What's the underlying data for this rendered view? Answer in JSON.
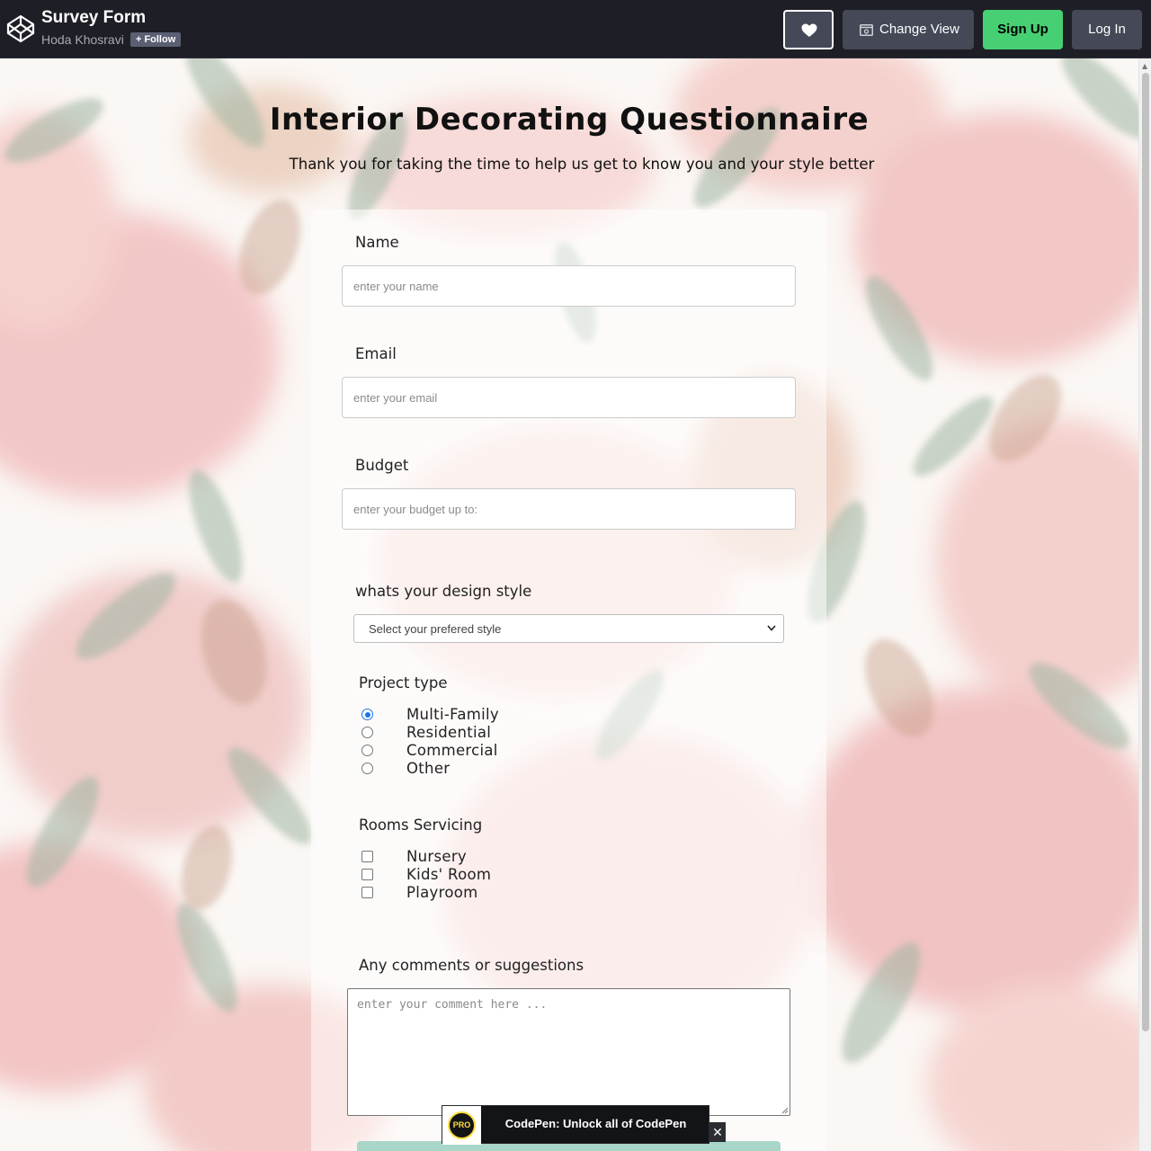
{
  "header": {
    "pen_title": "Survey Form",
    "author": "Hoda Khosravi",
    "follow_label": "Follow",
    "change_view_label": "Change View",
    "signup_label": "Sign Up",
    "login_label": "Log In"
  },
  "page": {
    "title": "Interior Decorating Questionnaire",
    "subtitle": "Thank you for taking the time to help us get to know you and your style better"
  },
  "form": {
    "name": {
      "label": "Name",
      "placeholder": "enter your name"
    },
    "email": {
      "label": "Email",
      "placeholder": "enter your email"
    },
    "budget": {
      "label": "Budget",
      "placeholder": "enter your budget up to:"
    },
    "design_style": {
      "label": "whats your design style",
      "selected": "Select your prefered style"
    },
    "project_type": {
      "label": "Project type",
      "options": [
        {
          "label": "Multi-Family",
          "checked": true
        },
        {
          "label": "Residential",
          "checked": false
        },
        {
          "label": "Commercial",
          "checked": false
        },
        {
          "label": "Other",
          "checked": false
        }
      ]
    },
    "rooms": {
      "label": "Rooms Servicing",
      "options": [
        {
          "label": "Nursery",
          "checked": false
        },
        {
          "label": "Kids' Room",
          "checked": false
        },
        {
          "label": "Playroom",
          "checked": false
        }
      ]
    },
    "comments": {
      "label": "Any comments or suggestions",
      "placeholder": "enter your comment here ..."
    }
  },
  "promo": {
    "badge": "PRO",
    "text": "CodePen: Unlock all of CodePen",
    "close": "✕"
  },
  "icons": [
    "codepen-logo-icon",
    "heart-icon",
    "change-view-icon",
    "plus-icon",
    "chevron-down-icon",
    "close-icon"
  ],
  "colors": {
    "topbar": "#1e1f26",
    "button_gray": "#444857",
    "signup_green": "#47cf73",
    "accent_blue": "#1a73e8",
    "pro_yellow": "#ffdd40",
    "submit_teal": "#a8d6c8"
  }
}
